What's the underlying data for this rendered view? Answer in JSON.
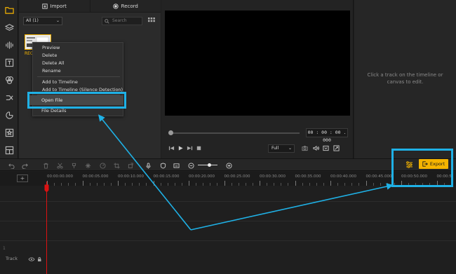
{
  "sidebar": {
    "icons": [
      "folder-icon",
      "layers-icon",
      "audio-wave-icon",
      "text-icon",
      "effects-icon",
      "transition-icon",
      "sticker-icon",
      "star-icon",
      "layout-icon"
    ]
  },
  "media_panel": {
    "import_label": "Import",
    "record_label": "Record",
    "filter_value": "All (1)",
    "search_placeholder": "Search",
    "thumbnail_label": "REC"
  },
  "context_menu": {
    "items": [
      "Preview",
      "Delete",
      "Delete All",
      "Rename",
      "Add to Timeline",
      "Add to Timeline (Silence Detection)",
      "Open File",
      "File Details"
    ],
    "highlighted": "Open File"
  },
  "player": {
    "timecode": "00 : 00 : 00 . 000",
    "quality": "Full"
  },
  "properties": {
    "hint": "Click a track on the timeline or canvas to edit."
  },
  "timeline": {
    "export_label": "Export",
    "add_track_label": "+",
    "ruler": [
      "00:00:00.000",
      "00:00:05.000",
      "00:00:10.000",
      "00:00:15.000",
      "00:00:20.000",
      "00:00:25.000",
      "00:00:30.000",
      "00:00:35.000",
      "00:00:40.000",
      "00:00:45.000",
      "00:00:50.000",
      "00:00:5"
    ],
    "track_label": "Track",
    "track_side_label": "1"
  },
  "colors": {
    "accent": "#f5b400",
    "annotation": "#1fb1e6",
    "playhead": "#dd1111"
  }
}
